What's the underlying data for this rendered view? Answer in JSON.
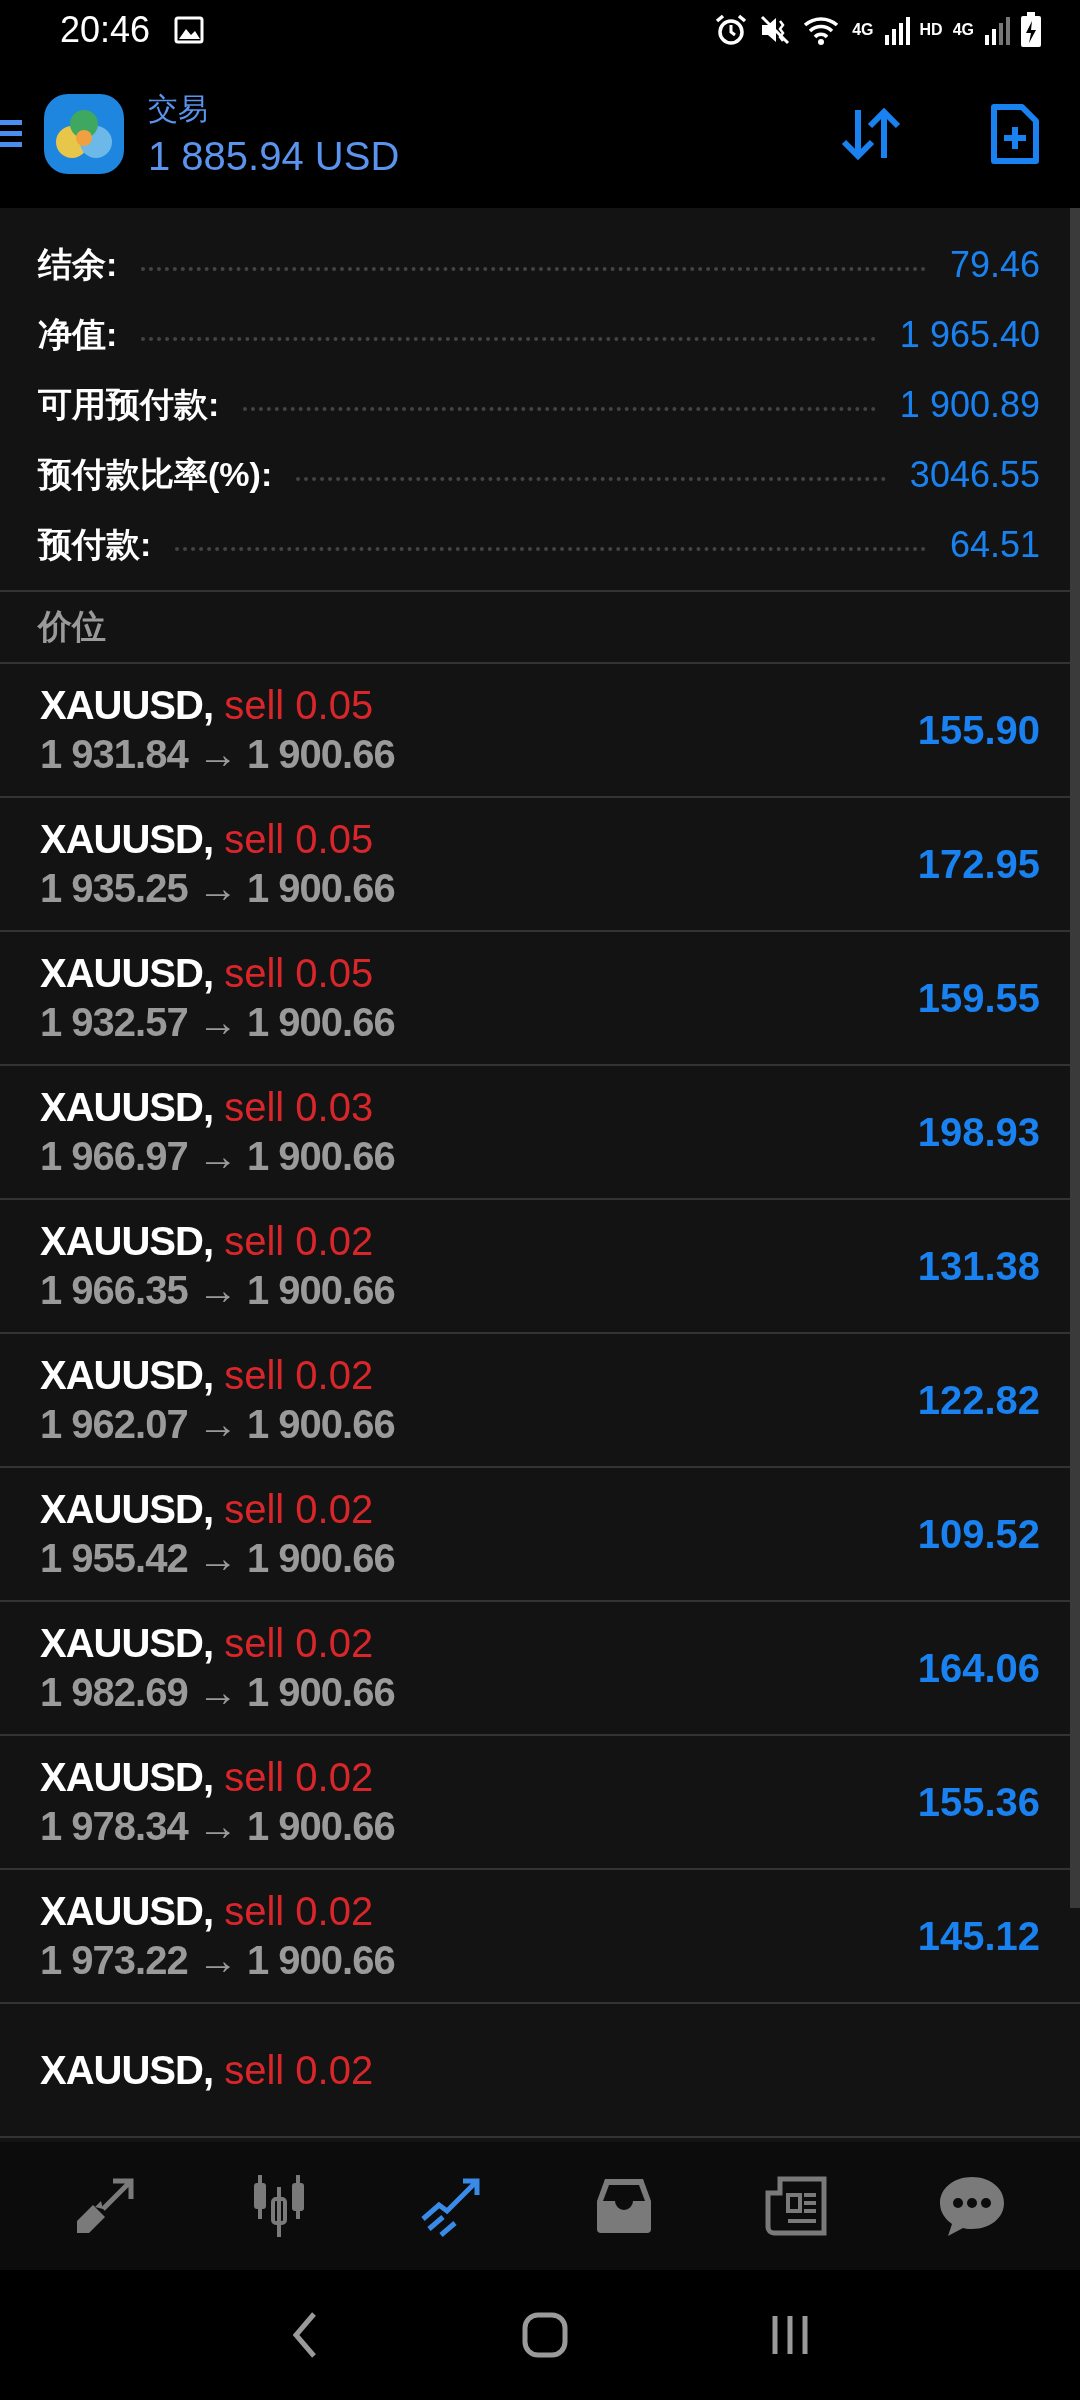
{
  "status_bar": {
    "time": "20:46",
    "network_labels": [
      "4G",
      "HD",
      "4G"
    ]
  },
  "header": {
    "title": "交易",
    "balance": "1 885.94 USD"
  },
  "summary": [
    {
      "label": "结余:",
      "value": "79.46"
    },
    {
      "label": "净值:",
      "value": "1 965.40"
    },
    {
      "label": "可用预付款:",
      "value": "1 900.89"
    },
    {
      "label": "预付款比率(%):",
      "value": "3046.55"
    },
    {
      "label": "预付款:",
      "value": "64.51"
    }
  ],
  "section_title": "价位",
  "positions": [
    {
      "symbol": "XAUUSD,",
      "side": "sell 0.05",
      "open": "1 931.84",
      "arrow": "→",
      "current": "1 900.66",
      "profit": "155.90"
    },
    {
      "symbol": "XAUUSD,",
      "side": "sell 0.05",
      "open": "1 935.25",
      "arrow": "→",
      "current": "1 900.66",
      "profit": "172.95"
    },
    {
      "symbol": "XAUUSD,",
      "side": "sell 0.05",
      "open": "1 932.57",
      "arrow": "→",
      "current": "1 900.66",
      "profit": "159.55"
    },
    {
      "symbol": "XAUUSD,",
      "side": "sell 0.03",
      "open": "1 966.97",
      "arrow": "→",
      "current": "1 900.66",
      "profit": "198.93"
    },
    {
      "symbol": "XAUUSD,",
      "side": "sell 0.02",
      "open": "1 966.35",
      "arrow": "→",
      "current": "1 900.66",
      "profit": "131.38"
    },
    {
      "symbol": "XAUUSD,",
      "side": "sell 0.02",
      "open": "1 962.07",
      "arrow": "→",
      "current": "1 900.66",
      "profit": "122.82"
    },
    {
      "symbol": "XAUUSD,",
      "side": "sell 0.02",
      "open": "1 955.42",
      "arrow": "→",
      "current": "1 900.66",
      "profit": "109.52"
    },
    {
      "symbol": "XAUUSD,",
      "side": "sell 0.02",
      "open": "1 982.69",
      "arrow": "→",
      "current": "1 900.66",
      "profit": "164.06"
    },
    {
      "symbol": "XAUUSD,",
      "side": "sell 0.02",
      "open": "1 978.34",
      "arrow": "→",
      "current": "1 900.66",
      "profit": "155.36"
    },
    {
      "symbol": "XAUUSD,",
      "side": "sell 0.02",
      "open": "1 973.22",
      "arrow": "→",
      "current": "1 900.66",
      "profit": "145.12"
    },
    {
      "symbol": "XAUUSD,",
      "side": "sell 0.02"
    }
  ],
  "bottom_nav": [
    {
      "kind": "quotes",
      "selected": false
    },
    {
      "kind": "chart",
      "selected": false
    },
    {
      "kind": "trade",
      "selected": true
    },
    {
      "kind": "history",
      "selected": false
    },
    {
      "kind": "news",
      "selected": false
    },
    {
      "kind": "chat",
      "selected": false
    }
  ]
}
